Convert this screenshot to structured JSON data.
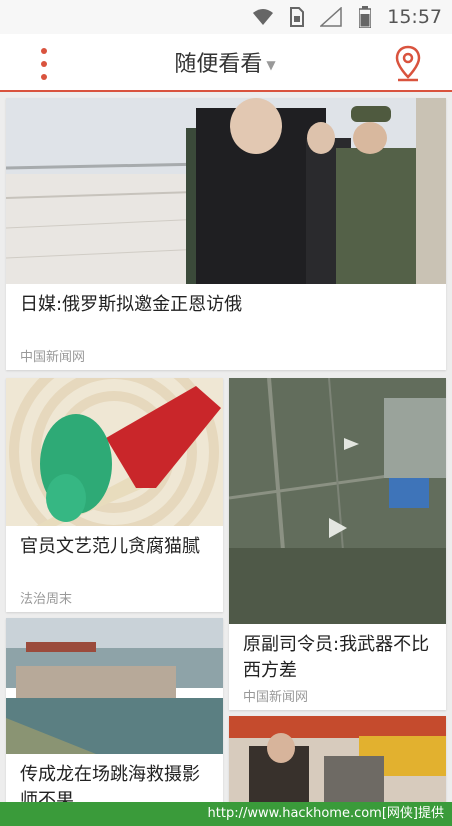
{
  "status_bar": {
    "time": "15:57",
    "icons": [
      "wifi-icon",
      "sim-icon",
      "signal-icon",
      "battery-icon"
    ]
  },
  "app_bar": {
    "title": "随便看看",
    "menu_icon": "more-vertical-icon",
    "location_icon": "location-pin-icon"
  },
  "feed": {
    "items": [
      {
        "title": "日媒:俄罗斯拟邀金正恩访俄",
        "source": "中国新闻网"
      },
      {
        "title": "官员文艺范儿贪腐猫腻",
        "source": "法治周末"
      },
      {
        "title": "原副司令员:我武器不比西方差",
        "source": "中国新闻网"
      },
      {
        "title": "传成龙在场跳海救摄影师不果",
        "source": ""
      }
    ]
  },
  "watermark": {
    "text": "http://www.hackhome.com[网侠]提供"
  },
  "colors": {
    "accent": "#d9533e",
    "watermark_bg": "#3a9b3a"
  }
}
